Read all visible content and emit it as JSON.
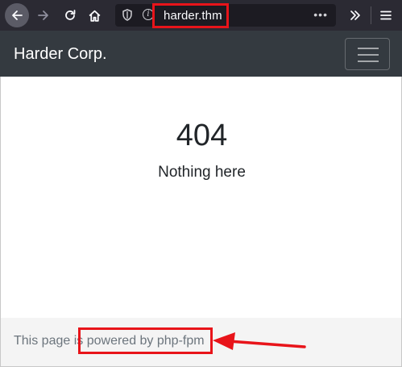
{
  "browser": {
    "url": "harder.thm",
    "page_actions": "•••"
  },
  "navbar": {
    "brand": "Harder Corp."
  },
  "main": {
    "code": "404",
    "message": "Nothing here"
  },
  "footer": {
    "text": "This page is powered by php-fpm"
  },
  "annotation": {
    "color": "#e8141a"
  }
}
